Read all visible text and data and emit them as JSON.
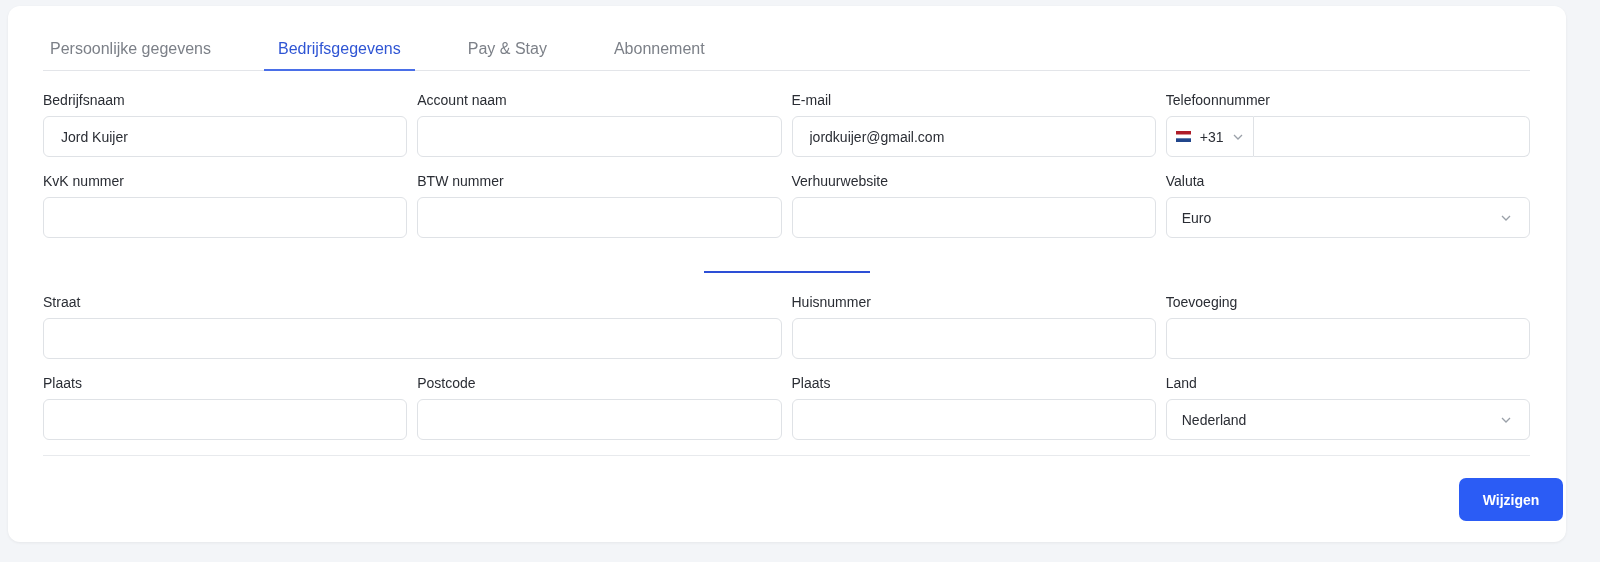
{
  "tabs": [
    {
      "label": "Persoonlijke gegevens",
      "selected": false
    },
    {
      "label": "Bedrijfsgegevens",
      "selected": true
    },
    {
      "label": "Pay & Stay",
      "selected": false
    },
    {
      "label": "Abonnement",
      "selected": false
    }
  ],
  "company_fields": [
    {
      "kind": "text",
      "label": "Bedrijfsnaam",
      "value": "Jord Kuijer"
    },
    {
      "kind": "text",
      "label": "Account naam"
    },
    {
      "kind": "text",
      "label": "E-mail",
      "value": "jordkuijer@gmail.com"
    },
    {
      "kind": "phone",
      "label": "Telefoonnummer",
      "country_code": "+31"
    },
    {
      "kind": "text",
      "label": "KvK nummer"
    },
    {
      "kind": "text",
      "label": "BTW nummer"
    },
    {
      "kind": "text",
      "label": "Verhuurwebsite"
    },
    {
      "kind": "select",
      "label": "Valuta",
      "value": "Euro"
    }
  ],
  "address_fields": [
    {
      "kind": "text",
      "label": "Straat",
      "wide": true
    },
    {
      "kind": "text",
      "label": "Huisnummer",
      "wide": false
    },
    {
      "kind": "text",
      "label": "Toevoeging",
      "wide": false
    },
    {
      "kind": "text",
      "label": "Plaats",
      "wide": false
    },
    {
      "kind": "text",
      "label": "Postcode",
      "wide": false
    },
    {
      "kind": "text",
      "label": "Plaats",
      "wide": false
    },
    {
      "kind": "select",
      "label": "Land",
      "value": "Nederland",
      "wide": false
    }
  ],
  "submit_button": "Wijzigen"
}
